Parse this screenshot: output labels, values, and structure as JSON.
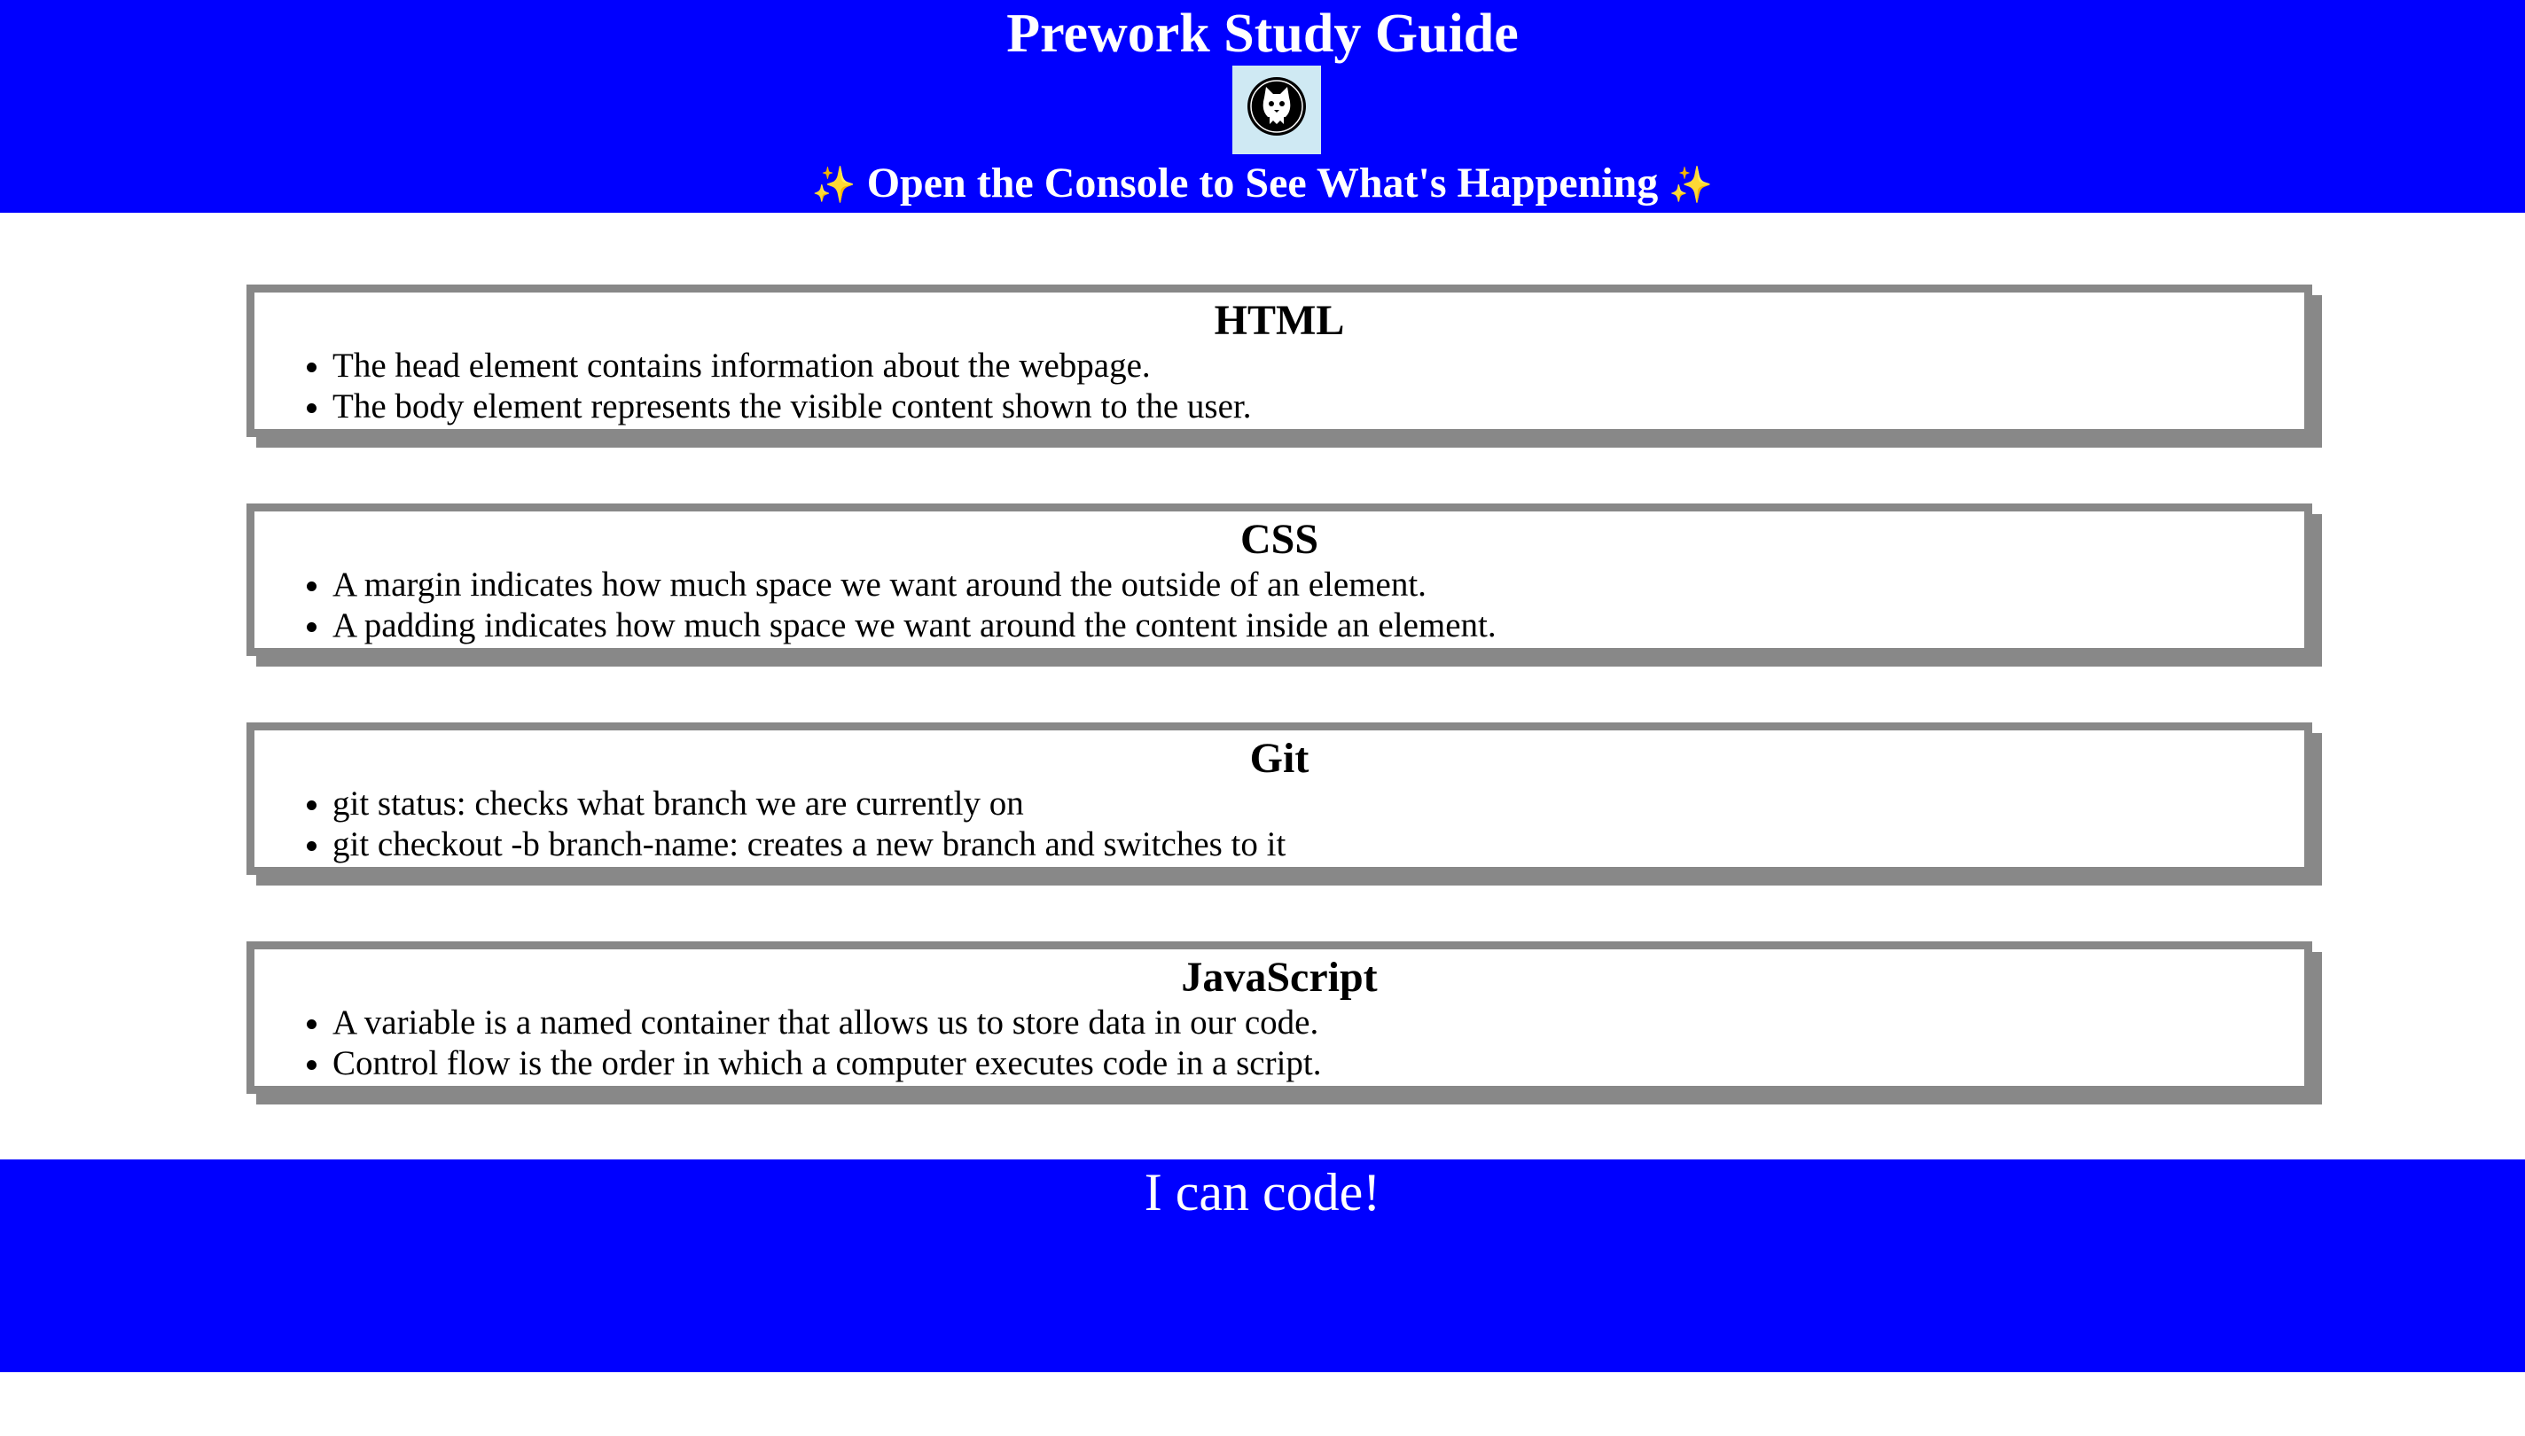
{
  "header": {
    "title": "Prework Study Guide",
    "subtitle": "Open the Console to See What's Happening",
    "sparkle": "✨",
    "logo_icon": "cat-logo-icon"
  },
  "sections": [
    {
      "title": "HTML",
      "items": [
        "The head element contains information about the webpage.",
        "The body element represents the visible content shown to the user."
      ]
    },
    {
      "title": "CSS",
      "items": [
        "A margin indicates how much space we want around the outside of an element.",
        "A padding indicates how much space we want around the content inside an element."
      ]
    },
    {
      "title": "Git",
      "items": [
        "git status: checks what branch we are currently on",
        "git checkout -b branch-name: creates a new branch and switches to it"
      ]
    },
    {
      "title": "JavaScript",
      "items": [
        "A variable is a named container that allows us to store data in our code.",
        "Control flow is the order in which a computer executes code in a script."
      ]
    }
  ],
  "footer": {
    "text": "I can code!"
  },
  "colors": {
    "header_bg": "#0000ff",
    "footer_bg": "#0000ff",
    "card_border": "#888888",
    "sparkle": "#f3d36b"
  }
}
